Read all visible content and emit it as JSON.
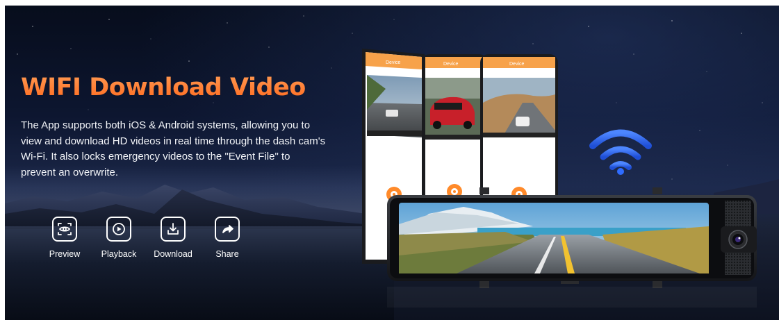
{
  "title": "WIFI Download Video",
  "description": "The App supports both iOS & Android systems, allowing you to view and download HD videos in real time through the dash cam's Wi-Fi. It also locks emergency videos to the \"Event File\" to prevent an overwrite.",
  "features": [
    {
      "label": "Preview",
      "icon": "eye-scan-icon"
    },
    {
      "label": "Playback",
      "icon": "play-circle-icon"
    },
    {
      "label": "Download",
      "icon": "download-icon"
    },
    {
      "label": "Share",
      "icon": "share-icon"
    }
  ],
  "phones": [
    {
      "header": "Device"
    },
    {
      "header": "Device"
    },
    {
      "header": "Device"
    }
  ],
  "colors": {
    "accent": "#ff7a33",
    "wifi": "#2f6cff",
    "background": "#0d1630"
  }
}
